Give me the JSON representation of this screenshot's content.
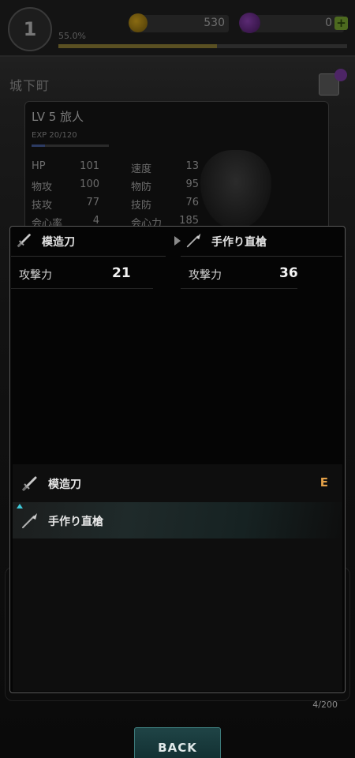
{
  "topbar": {
    "player_level": "1",
    "exp_percent": "55.0%",
    "exp_progress": 0.55,
    "gold": "530",
    "gems": "0"
  },
  "town": {
    "name": "城下町"
  },
  "status": {
    "title": "LV 5 旅人",
    "exp_text": "EXP 20/120",
    "exp_progress": 0.17,
    "stats": [
      {
        "l1": "HP",
        "v1": "101",
        "l2": "速度",
        "v2": "13"
      },
      {
        "l1": "物攻",
        "v1": "100",
        "l2": "物防",
        "v2": "95"
      },
      {
        "l1": "技攻",
        "v1": "77",
        "l2": "技防",
        "v2": "76"
      },
      {
        "l1": "会心率",
        "v1": "4",
        "l2": "会心力",
        "v2": "185"
      }
    ]
  },
  "compare": {
    "current": {
      "name": "模造刀",
      "icon": "sword-icon",
      "stat_label": "攻撃力",
      "stat_value": "21"
    },
    "candidate": {
      "name": "手作り直槍",
      "icon": "spear-icon",
      "stat_label": "攻撃力",
      "stat_value": "36"
    }
  },
  "inventory": {
    "items": [
      {
        "name": "模造刀",
        "icon": "sword-icon",
        "tag": "E"
      },
      {
        "name": "手作り直槍",
        "icon": "spear-icon",
        "tag": ""
      }
    ],
    "count": "4/200"
  },
  "back_button": {
    "label": "BACK"
  },
  "colors": {
    "accent_teal": "#3ec9d9",
    "equipped_orange": "#e3a048",
    "button_teal": "#1f4446"
  }
}
